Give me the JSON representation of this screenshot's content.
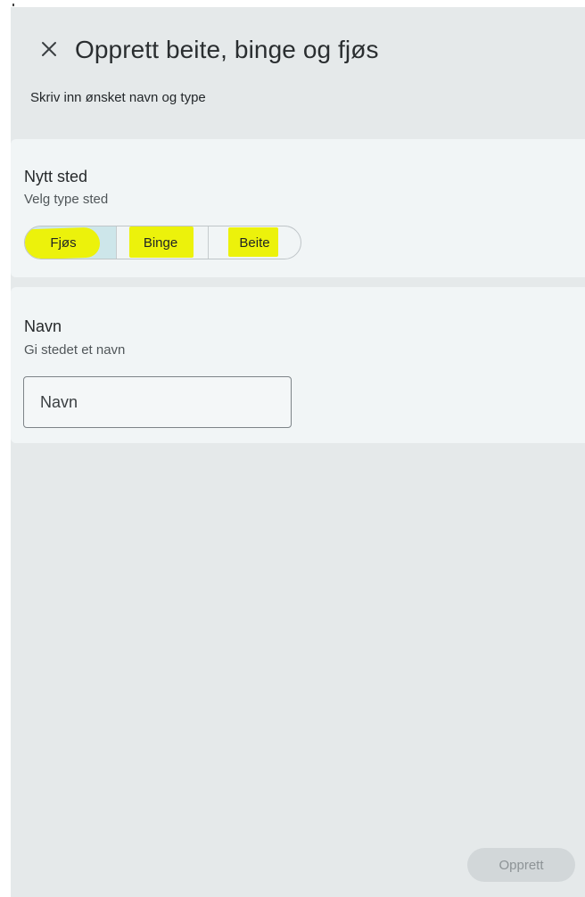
{
  "header": {
    "title": "Opprett beite, binge og fjøs",
    "subtitle": "Skriv inn ønsket navn og type",
    "close_icon": "close-icon"
  },
  "type_section": {
    "heading": "Nytt sted",
    "help": "Velg type sted",
    "options": [
      {
        "label": "Fjøs",
        "selected": true,
        "highlighted": true
      },
      {
        "label": "Binge",
        "selected": false,
        "highlighted": true
      },
      {
        "label": "Beite",
        "selected": false,
        "highlighted": true
      }
    ]
  },
  "name_section": {
    "heading": "Navn",
    "help": "Gi stedet et navn",
    "input_placeholder": "Navn",
    "input_value": ""
  },
  "actions": {
    "submit_label": "Opprett",
    "submit_enabled": false
  },
  "colors": {
    "background": "#e5e9ea",
    "card": "#f1f5f6",
    "selected_segment": "#cde6ea",
    "highlight": "#ecf20b",
    "disabled_button": "#d2d7d9"
  }
}
